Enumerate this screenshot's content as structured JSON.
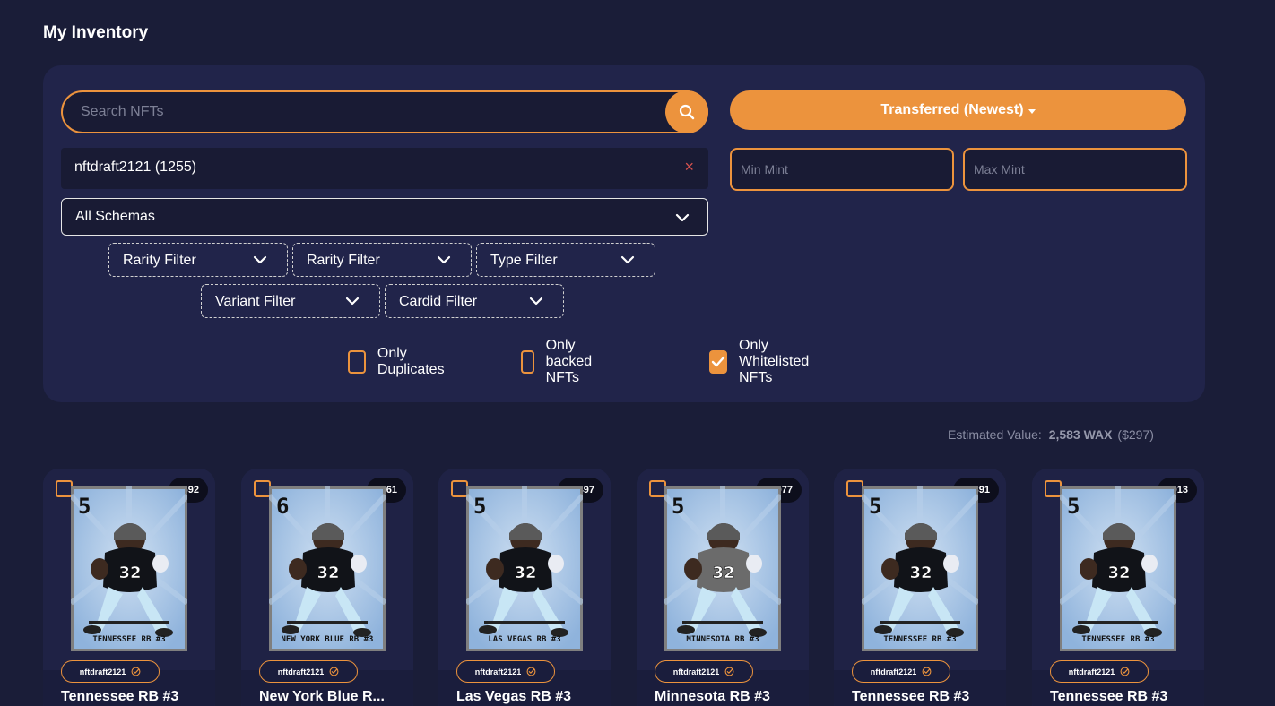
{
  "page": {
    "title": "My Inventory"
  },
  "search": {
    "placeholder": "Search NFTs"
  },
  "owner_filter": {
    "label": "nftdraft2121 (1255)",
    "clear": "×"
  },
  "schema_select": {
    "value": "All Schemas"
  },
  "dropdowns": [
    {
      "label": "Rarity Filter"
    },
    {
      "label": "Rarity Filter"
    },
    {
      "label": "Type Filter"
    },
    {
      "label": "Variant Filter"
    },
    {
      "label": "Cardid Filter"
    }
  ],
  "checkboxes": [
    {
      "label": "Only Duplicates",
      "checked": false
    },
    {
      "label": "Only backed NFTs",
      "checked": false
    },
    {
      "label": "Only Whitelisted NFTs",
      "checked": true
    }
  ],
  "sort": {
    "label": "Transferred (Newest)"
  },
  "mint": {
    "min_placeholder": "Min Mint",
    "max_placeholder": "Max Mint"
  },
  "estimated": {
    "label": "Estimated Value:",
    "wax": "2,583 WAX",
    "usd": "($297)"
  },
  "cards": [
    {
      "mint": "#692",
      "owner": "nftdraft2121",
      "name": "Tennessee RB #3",
      "number": "5",
      "caption": "TENNESSEE RB #3",
      "jersey": "#111318"
    },
    {
      "mint": "#561",
      "owner": "nftdraft2121",
      "name": "New York Blue R...",
      "number": "6",
      "caption": "NEW YORK BLUE RB #3",
      "jersey": "#111318"
    },
    {
      "mint": "#1497",
      "owner": "nftdraft2121",
      "name": "Las Vegas RB #3",
      "number": "5",
      "caption": "LAS VEGAS RB #3",
      "jersey": "#111318"
    },
    {
      "mint": "#1077",
      "owner": "nftdraft2121",
      "name": "Minnesota RB #3",
      "number": "5",
      "caption": "MINNESOTA RB #3",
      "jersey": "#6b6b6b"
    },
    {
      "mint": "#1391",
      "owner": "nftdraft2121",
      "name": "Tennessee RB #3",
      "number": "5",
      "caption": "TENNESSEE RB #3",
      "jersey": "#111318"
    },
    {
      "mint": "#913",
      "owner": "nftdraft2121",
      "name": "Tennessee RB #3",
      "number": "5",
      "caption": "TENNESSEE RB #3",
      "jersey": "#111318"
    }
  ],
  "colors": {
    "accent": "#ec933d",
    "background": "#1a1d38",
    "panel": "#21244a"
  }
}
